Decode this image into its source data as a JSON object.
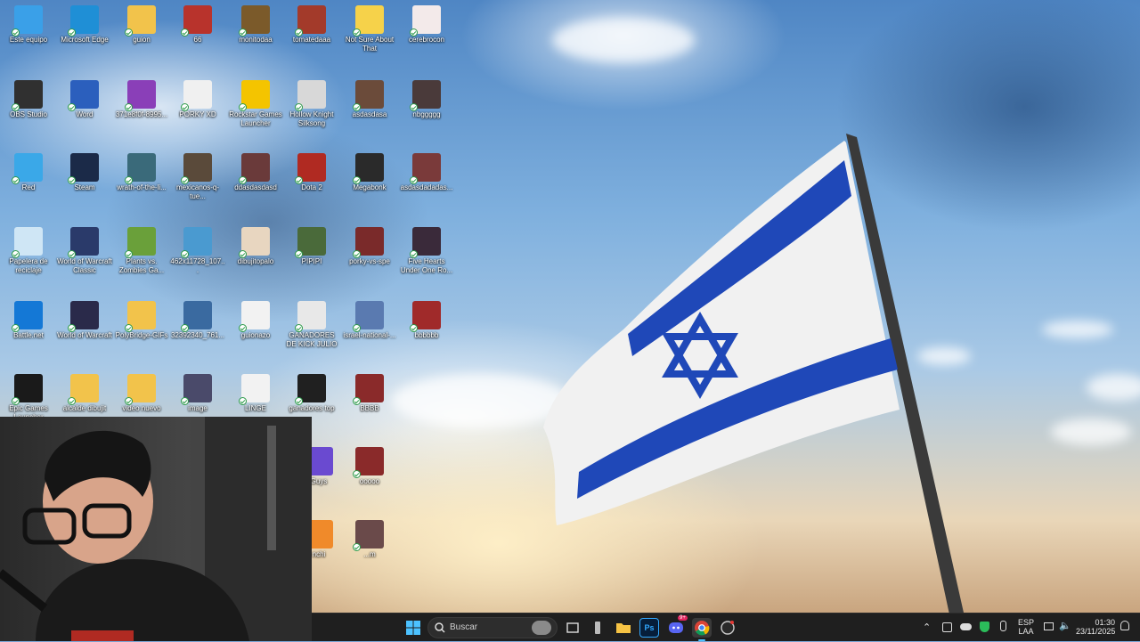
{
  "desktop": {
    "icons": [
      {
        "label": "Este equipo",
        "color": "#3aa0e8"
      },
      {
        "label": "Microsoft Edge",
        "color": "#1f8fd6"
      },
      {
        "label": "guion",
        "color": "#f2c34b"
      },
      {
        "label": "66",
        "color": "#b8332c"
      },
      {
        "label": "monitodaa",
        "color": "#7b5a2a"
      },
      {
        "label": "tomatedaaa",
        "color": "#a33a2a"
      },
      {
        "label": "Not Sure About That",
        "color": "#f6d24a"
      },
      {
        "label": "cerebrocon",
        "color": "#f3eaea"
      },
      {
        "label": "OBS Studio",
        "color": "#303030"
      },
      {
        "label": "Word",
        "color": "#2b5fbd"
      },
      {
        "label": "371e8f0f-8995...",
        "color": "#8a3fb8"
      },
      {
        "label": "PORKY XD",
        "color": "#f0f0f0"
      },
      {
        "label": "Rockstar Games Launcher",
        "color": "#f4c400"
      },
      {
        "label": "Hollow Knight Silksong",
        "color": "#d8d8d8"
      },
      {
        "label": "asdasdasa",
        "color": "#6b4b3a"
      },
      {
        "label": "nbggggg",
        "color": "#4a3a3a"
      },
      {
        "label": "Red",
        "color": "#3aa8e8"
      },
      {
        "label": "Steam",
        "color": "#1b2a48"
      },
      {
        "label": "wrath-of-the-li...",
        "color": "#3a6a7a"
      },
      {
        "label": "mexicanos-q-tue...",
        "color": "#5a4a3a"
      },
      {
        "label": "ddasdasdasd",
        "color": "#6a3a3a"
      },
      {
        "label": "Dota 2",
        "color": "#b02a22"
      },
      {
        "label": "Megabonk",
        "color": "#2a2a2a"
      },
      {
        "label": "asdasdadadas...",
        "color": "#7a3a3a"
      },
      {
        "label": "Papelera de reciclaje",
        "color": "#cfe6f5"
      },
      {
        "label": "World of Warcraft Classic",
        "color": "#2a3a6a"
      },
      {
        "label": "Plants vs. Zombies Ga...",
        "color": "#6aa03a"
      },
      {
        "label": "462x11728_107...",
        "color": "#4a9ad0"
      },
      {
        "label": "dibujitopalo",
        "color": "#e8d6c0"
      },
      {
        "label": "PIPIPI",
        "color": "#4a6a3a"
      },
      {
        "label": "porky-vs-spe",
        "color": "#7a2a2a"
      },
      {
        "label": "Five Hearts Under One Ro...",
        "color": "#3a2a3a"
      },
      {
        "label": "Battle.net",
        "color": "#1478d6"
      },
      {
        "label": "World of Warcraft",
        "color": "#2a2a4a"
      },
      {
        "label": "PolyBridge-GIFs",
        "color": "#f2c34b"
      },
      {
        "label": "32392340_761...",
        "color": "#3a6aa0"
      },
      {
        "label": "guionazo",
        "color": "#f2f2f2"
      },
      {
        "label": "GANADORES DE KICK JULIO",
        "color": "#e8e8e8"
      },
      {
        "label": "israel-national-...",
        "color": "#5a7ab0"
      },
      {
        "label": "bbbbbb",
        "color": "#a02a2a"
      },
      {
        "label": "Epic Games Launcher",
        "color": "#1a1a1a"
      },
      {
        "label": "alcalde dibujit",
        "color": "#f2c34b"
      },
      {
        "label": "video nuevo",
        "color": "#f2c34b"
      },
      {
        "label": "image",
        "color": "#4a4a6a"
      },
      {
        "label": "LINGE",
        "color": "#f2f2f2"
      },
      {
        "label": "ganadores top",
        "color": "#202020"
      },
      {
        "label": "BBBB",
        "color": "#8a2a2a"
      },
      {
        "label": "Guys",
        "color": "#6a4ad0"
      },
      {
        "label": "ooooo",
        "color": "#8a2a2a"
      },
      {
        "label": "nchi",
        "color": "#f08a2a"
      },
      {
        "label": "...m",
        "color": "#6a4a4a"
      }
    ]
  },
  "taskbar": {
    "search_placeholder": "Buscar",
    "language": "ESP",
    "layout": "LAA",
    "time": "01:30",
    "date": "23/11/2025",
    "discord_badge": "9+",
    "ps_label": "Ps"
  }
}
